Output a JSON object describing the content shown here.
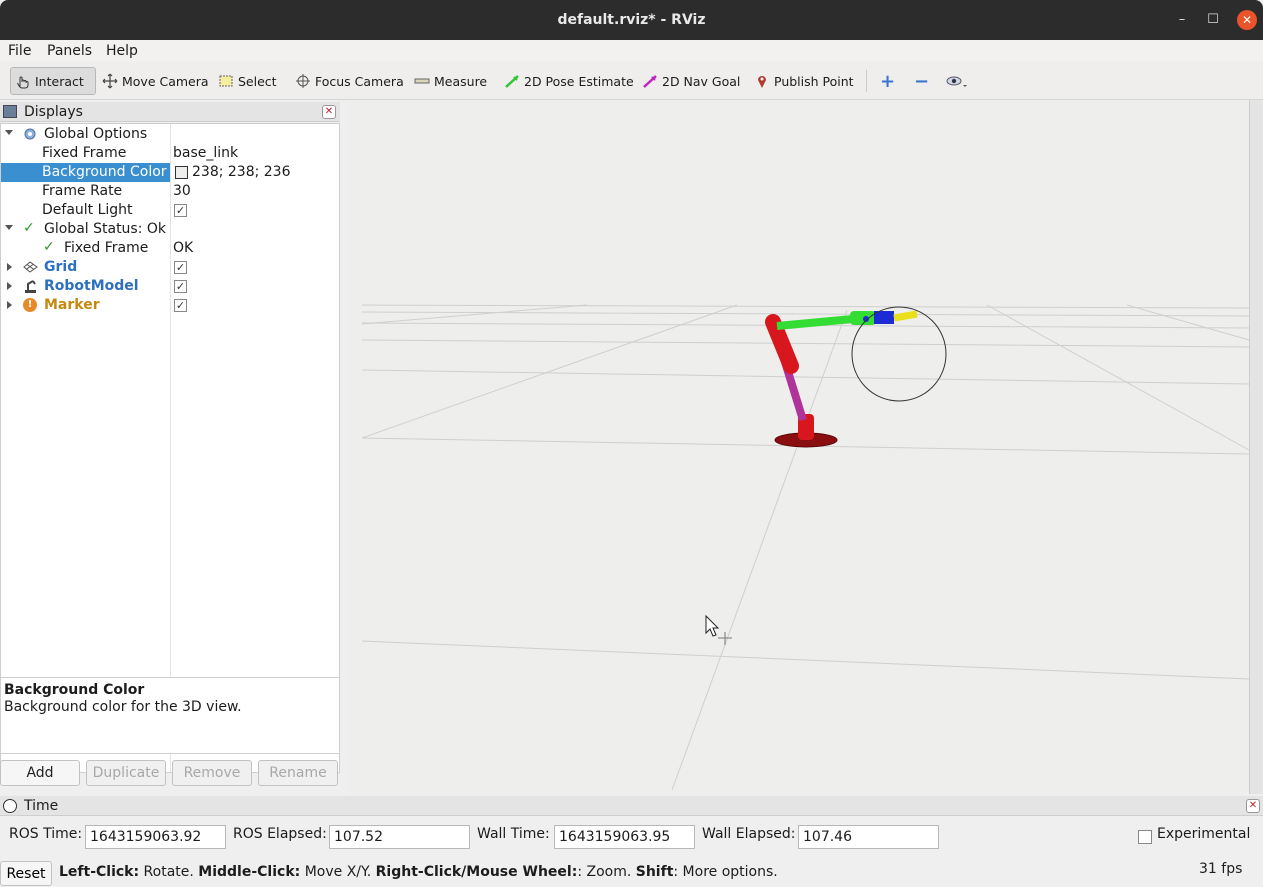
{
  "window": {
    "title": "default.rviz* - RViz",
    "minimize": "–",
    "maximize": "☐",
    "close": "✕"
  },
  "menu": [
    "File",
    "Panels",
    "Help"
  ],
  "toolbar": {
    "interact": "Interact",
    "move_camera": "Move Camera",
    "select": "Select",
    "focus_camera": "Focus Camera",
    "measure": "Measure",
    "pose_estimate": "2D Pose Estimate",
    "nav_goal": "2D Nav Goal",
    "publish_point": "Publish Point",
    "plus": "+",
    "minus": "−"
  },
  "displays": {
    "title": "Displays",
    "rows": {
      "global_options": "Global Options",
      "fixed_frame_label": "Fixed Frame",
      "fixed_frame_value": "base_link",
      "background_color_label": "Background Color",
      "background_color_value": "238; 238; 236",
      "frame_rate_label": "Frame Rate",
      "frame_rate_value": "30",
      "default_light_label": "Default Light",
      "global_status": "Global Status: Ok",
      "status_fixed_frame_label": "Fixed Frame",
      "status_fixed_frame_value": "OK",
      "grid": "Grid",
      "robot_model": "RobotModel",
      "marker": "Marker"
    },
    "description": {
      "title": "Background Color",
      "text": "Background color for the 3D view."
    },
    "buttons": {
      "add": "Add",
      "duplicate": "Duplicate",
      "remove": "Remove",
      "rename": "Rename"
    }
  },
  "time": {
    "title": "Time",
    "ros_time_label": "ROS Time:",
    "ros_time_value": "1643159063.92",
    "ros_elapsed_label": "ROS Elapsed:",
    "ros_elapsed_value": "107.52",
    "wall_time_label": "Wall Time:",
    "wall_time_value": "1643159063.95",
    "wall_elapsed_label": "Wall Elapsed:",
    "wall_elapsed_value": "107.46",
    "experimental": "Experimental"
  },
  "status": {
    "reset": "Reset",
    "k1": "Left-Click:",
    "v1": " Rotate. ",
    "k2": "Middle-Click:",
    "v2": " Move X/Y. ",
    "k3": "Right-Click/Mouse Wheel:",
    "v3": ": Zoom. ",
    "k4": "Shift",
    "v4": ": More options.",
    "fps": "31 fps"
  },
  "colors": {
    "selection": "#3a8fd0",
    "background": "#eeeeec",
    "link_red": "#e01b24",
    "link_green": "#33dd33",
    "link_blue": "#1d2bd6",
    "link_magenta": "#b0339a"
  }
}
